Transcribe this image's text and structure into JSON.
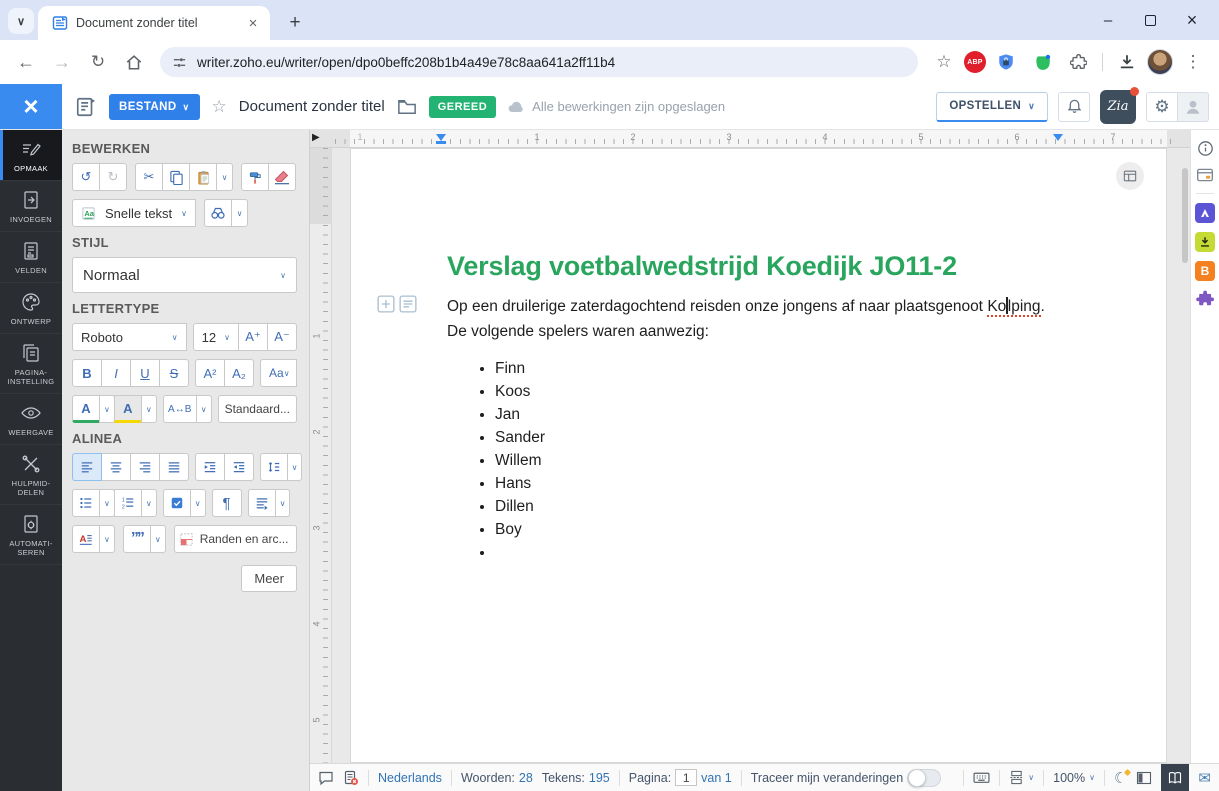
{
  "browser": {
    "tab_title": "Document zonder titel",
    "url": "writer.zoho.eu/writer/open/dpo0beffc208b1b4a49e78c8aa641a2ff11b4",
    "ext_abp": "ABP"
  },
  "appbar": {
    "file_menu": "BESTAND",
    "doc_title": "Document zonder titel",
    "ready_badge": "GEREED",
    "saved_message": "Alle bewerkingen zijn opgeslagen",
    "compose_button": "OPSTELLEN",
    "zia": "Zia"
  },
  "nav": {
    "items": [
      {
        "label": "OPMAAK"
      },
      {
        "label": "INVOEGEN"
      },
      {
        "label": "VELDEN"
      },
      {
        "label": "ONTWERP"
      },
      {
        "label": "PAGINA-INSTELLING"
      },
      {
        "label": "WEERGAVE"
      },
      {
        "label": "HULPMID-DELEN"
      },
      {
        "label": "AUTOMATI-SEREN"
      }
    ]
  },
  "panel": {
    "bewerken_header": "BEWERKEN",
    "stijl_header": "STIJL",
    "lettertype_header": "LETTERTYPE",
    "alinea_header": "ALINEA",
    "quick_text": "Snelle tekst",
    "style_value": "Normaal",
    "font_family": "Roboto",
    "font_size": "12",
    "buttons": {
      "size_up": "A⁺",
      "size_down": "A⁻",
      "bold": "B",
      "italic": "I",
      "underline": "U",
      "strike": "S",
      "superscript": "A²",
      "subscript": "A₂",
      "case": "Aa",
      "font_color": "A",
      "highlight": "A",
      "spacing": "A↔B",
      "default": "Standaard...",
      "pilcrow": "¶",
      "drop_cap": "A",
      "quote": "””",
      "borders": "Randen en arc...",
      "more": "Meer"
    }
  },
  "ruler": {
    "h_numbers": [
      "1",
      "1",
      "2",
      "3",
      "4",
      "5",
      "6",
      "7"
    ],
    "v_numbers": [
      "1",
      "2",
      "3",
      "4",
      "5"
    ]
  },
  "document": {
    "title": "Verslag voetbalwedstrijd Koedijk JO11-2",
    "para1_before": "Op een druilerige zaterdagochtend reisden onze jongens af naar plaatsgenoot ",
    "misspelled_before_cursor": "Ko",
    "misspelled_after_cursor": "lping",
    "para1_end": ".",
    "para2": "De volgende spelers waren aanwezig:",
    "players": [
      "Finn",
      "Koos",
      "Jan",
      "Sander",
      "Willem",
      "Hans",
      "Dillen",
      "Boy",
      ""
    ]
  },
  "statusbar": {
    "language": "Nederlands",
    "words_label": "Woorden:",
    "words_value": "28",
    "chars_label": "Tekens:",
    "chars_value": "195",
    "page_label": "Pagina:",
    "page_current": "1",
    "page_of": "van 1",
    "track_changes_label": "Traceer mijn veranderingen",
    "zoom_value": "100%"
  },
  "colors": {
    "accent_blue": "#3a8bf0",
    "ready_green": "#23b373",
    "doc_title_green": "#29a55e",
    "zia_notification_red": "#e8503a",
    "abp_red": "#e01e2c"
  }
}
